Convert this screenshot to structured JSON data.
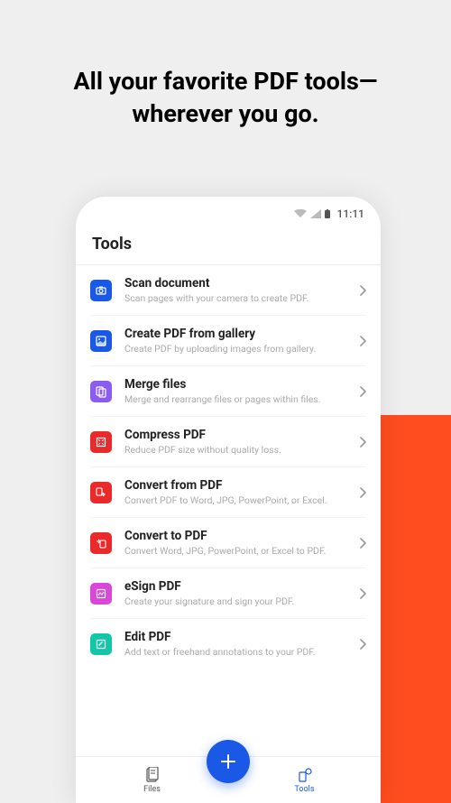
{
  "headline": "All your favorite PDF tools—wherever you go.",
  "status": {
    "time": "11:11"
  },
  "screen_title": "Tools",
  "tools": [
    {
      "title": "Scan document",
      "sub": "Scan pages with your camera to create PDF.",
      "color": "c-blue",
      "icon": "camera"
    },
    {
      "title": "Create PDF from gallery",
      "sub": "Create PDF by uploading images from gallery.",
      "color": "c-blue",
      "icon": "image"
    },
    {
      "title": "Merge files",
      "sub": "Merge and rearrange files or pages within files.",
      "color": "c-purple",
      "icon": "merge"
    },
    {
      "title": "Compress PDF",
      "sub": "Reduce PDF size without quality loss.",
      "color": "c-red",
      "icon": "compress"
    },
    {
      "title": "Convert from PDF",
      "sub": "Convert PDF to Word, JPG, PowerPoint, or Excel.",
      "color": "c-red",
      "icon": "convert-from"
    },
    {
      "title": "Convert to PDF",
      "sub": "Convert Word, JPG, PowerPoint, or Excel to PDF.",
      "color": "c-red",
      "icon": "convert-to"
    },
    {
      "title": "eSign PDF",
      "sub": "Create your signature and sign your PDF.",
      "color": "c-pink",
      "icon": "sign"
    },
    {
      "title": "Edit PDF",
      "sub": "Add text or freehand annotations to your PDF.",
      "color": "c-teal",
      "icon": "edit"
    }
  ],
  "nav": {
    "files": "Files",
    "tools": "Tools"
  }
}
